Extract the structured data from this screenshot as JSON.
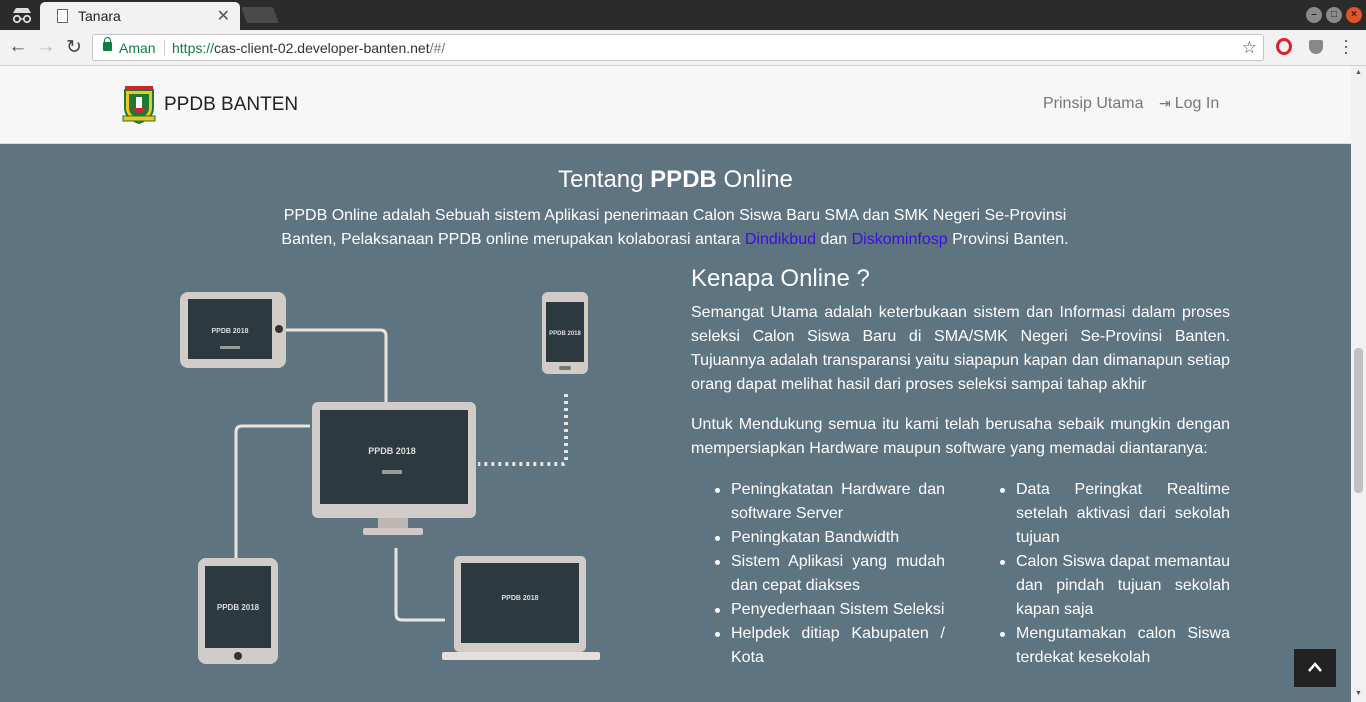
{
  "browser": {
    "tab_title": "Tanara",
    "security_label": "Aman",
    "url_scheme": "https://",
    "url_host": "cas-client-02.developer-banten.net",
    "url_path": "/#/"
  },
  "navbar": {
    "brand": "PPDB BANTEN",
    "links": [
      "Prinsip Utama",
      "Log In"
    ]
  },
  "about": {
    "title_prefix": "Tentang",
    "title_bold": "PPDB",
    "title_suffix": "Online",
    "text_part1": "PPDB Online adalah Sebuah sistem Aplikasi penerimaan Calon Siswa Baru SMA dan SMK Negeri Se-Provinsi Banten, Pelaksanaan PPDB online merupakan kolaborasi antara",
    "link1": "Dindikbud",
    "text_part2": "dan",
    "link2": "Diskominfosp",
    "text_part3": "Provinsi Banten."
  },
  "illustration": {
    "screen_label": "PPDB 2018"
  },
  "why": {
    "title": "Kenapa Online ?",
    "para1": "Semangat Utama adalah keterbukaan sistem dan Informasi dalam proses seleksi Calon Siswa Baru di SMA/SMK Negeri Se-Provinsi Banten. Tujuannya adalah transparansi yaitu siapapun kapan dan dimanapun setiap orang dapat melihat hasil dari proses seleksi sampai tahap akhir",
    "para2": "Untuk Mendukung semua itu kami telah berusaha sebaik mungkin dengan mempersiapkan Hardware maupun software yang memadai diantaranya:",
    "list_left": [
      "Peningkatatan Hardware dan software Server",
      "Peningkatan Bandwidth",
      "Sistem Aplikasi yang mudah dan cepat diakses",
      "Penyederhaan Sistem Seleksi",
      "Helpdek ditiap Kabupaten / Kota"
    ],
    "list_right": [
      "Data Peringkat Realtime setelah aktivasi dari sekolah tujuan",
      "Calon Siswa dapat memantau dan pindah tujuan sekolah kapan saja",
      "Mengutamakan calon Siswa terdekat kesekolah"
    ]
  },
  "colors": {
    "page_bg": "#5e7480",
    "navbar_bg": "#f7f7f7",
    "link": "#3b0fe0",
    "secure_green": "#0b8043"
  }
}
